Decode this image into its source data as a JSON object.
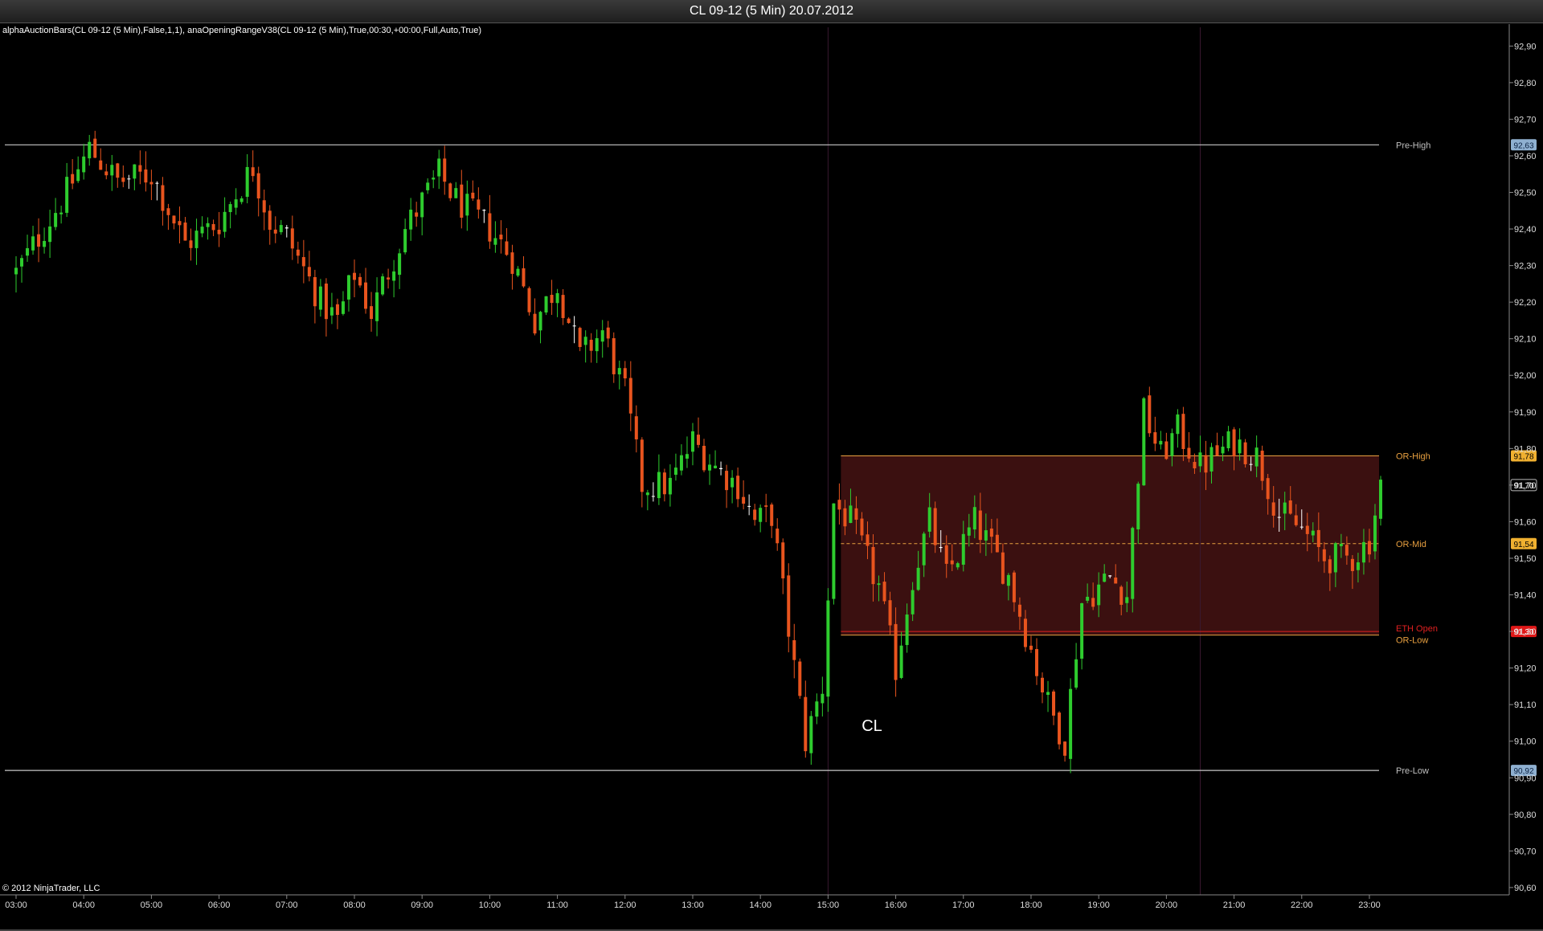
{
  "window": {
    "title": "CL 09-12 (5 Min)  20.07.2012"
  },
  "indicator_label": "alphaAuctionBars(CL 09-12 (5 Min),False,1,1), anaOpeningRangeV38(CL 09-12 (5 Min),True,00:30,+00:00,Full,Auto,True)",
  "copyright": "© 2012 NinjaTrader, LLC",
  "watermark": "CL",
  "colors": {
    "background": "#000000",
    "up": "#2ecc2e",
    "down": "#e8541e",
    "neutral": "#ffffff",
    "range_fill": "#3b1010",
    "range_line": "#e8a040",
    "level_line": "#c8c8c8",
    "open_line": "#e02020"
  },
  "chart_data": {
    "type": "candlestick",
    "x_ticks": [
      "03:00",
      "04:00",
      "05:00",
      "06:00",
      "07:00",
      "08:00",
      "09:00",
      "10:00",
      "11:00",
      "12:00",
      "13:00",
      "14:00",
      "15:00",
      "16:00",
      "17:00",
      "18:00",
      "19:00",
      "20:00",
      "21:00",
      "22:00",
      "23:00"
    ],
    "y_ticks": [
      "92,90",
      "92,80",
      "92,70",
      "92,60",
      "92,50",
      "92,40",
      "92,30",
      "92,20",
      "92,10",
      "92,00",
      "91,90",
      "91,80",
      "91,70",
      "91,60",
      "91,50",
      "91,40",
      "91,30",
      "91,20",
      "91,10",
      "91,00",
      "90,90",
      "90,80",
      "90,70",
      "90,60"
    ],
    "ylim": [
      90.58,
      92.96
    ],
    "levels": [
      {
        "name": "Pre-High",
        "value": 92.63,
        "label": "92,63"
      },
      {
        "name": "OR-High",
        "value": 91.78,
        "label": "91,78"
      },
      {
        "name": "OR-Mid",
        "value": 91.54,
        "label": "91,54"
      },
      {
        "name": "ETH Open",
        "value": 91.3,
        "label": "91,30"
      },
      {
        "name": "OR-Low",
        "value": 91.29,
        "label": ""
      },
      {
        "name": "Pre-Low",
        "value": 90.92,
        "label": "90,92"
      }
    ],
    "last_price": "91,70",
    "last_value": 91.7,
    "session_start": "15:00",
    "or_end": "15:30",
    "vline_times": [
      "15:00",
      "20:30"
    ],
    "anchors": [
      [
        "03:00",
        92.28
      ],
      [
        "03:45",
        92.5
      ],
      [
        "04:05",
        92.62
      ],
      [
        "04:30",
        92.53
      ],
      [
        "05:00",
        92.55
      ],
      [
        "05:30",
        92.36
      ],
      [
        "06:00",
        92.42
      ],
      [
        "06:30",
        92.57
      ],
      [
        "06:45",
        92.42
      ],
      [
        "07:00",
        92.38
      ],
      [
        "07:30",
        92.2
      ],
      [
        "07:45",
        92.15
      ],
      [
        "08:00",
        92.28
      ],
      [
        "08:15",
        92.17
      ],
      [
        "08:45",
        92.4
      ],
      [
        "09:15",
        92.55
      ],
      [
        "09:30",
        92.48
      ],
      [
        "10:00",
        92.4
      ],
      [
        "10:20",
        92.32
      ],
      [
        "10:40",
        92.15
      ],
      [
        "11:00",
        92.25
      ],
      [
        "11:20",
        92.05
      ],
      [
        "11:40",
        92.12
      ],
      [
        "12:00",
        91.95
      ],
      [
        "12:15",
        91.7
      ],
      [
        "12:40",
        91.7
      ],
      [
        "13:00",
        91.82
      ],
      [
        "13:20",
        91.75
      ],
      [
        "13:40",
        91.7
      ],
      [
        "13:55",
        91.6
      ],
      [
        "14:10",
        91.62
      ],
      [
        "14:30",
        91.2
      ],
      [
        "14:40",
        91.0
      ],
      [
        "14:55",
        91.15
      ],
      [
        "15:05",
        91.65
      ],
      [
        "15:20",
        91.6
      ],
      [
        "15:45",
        91.42
      ],
      [
        "16:00",
        91.2
      ],
      [
        "16:15",
        91.45
      ],
      [
        "16:30",
        91.6
      ],
      [
        "16:45",
        91.45
      ],
      [
        "17:10",
        91.6
      ],
      [
        "17:40",
        91.45
      ],
      [
        "18:00",
        91.25
      ],
      [
        "18:15",
        91.1
      ],
      [
        "18:30",
        91.0
      ],
      [
        "18:45",
        91.38
      ],
      [
        "19:10",
        91.45
      ],
      [
        "19:25",
        91.4
      ],
      [
        "19:40",
        91.9
      ],
      [
        "19:55",
        91.78
      ],
      [
        "20:10",
        91.85
      ],
      [
        "20:30",
        91.75
      ],
      [
        "21:00",
        91.82
      ],
      [
        "21:20",
        91.78
      ],
      [
        "21:40",
        91.62
      ],
      [
        "22:00",
        91.58
      ],
      [
        "22:20",
        91.5
      ],
      [
        "22:45",
        91.5
      ],
      [
        "23:00",
        91.55
      ],
      [
        "23:10",
        91.7
      ]
    ]
  }
}
